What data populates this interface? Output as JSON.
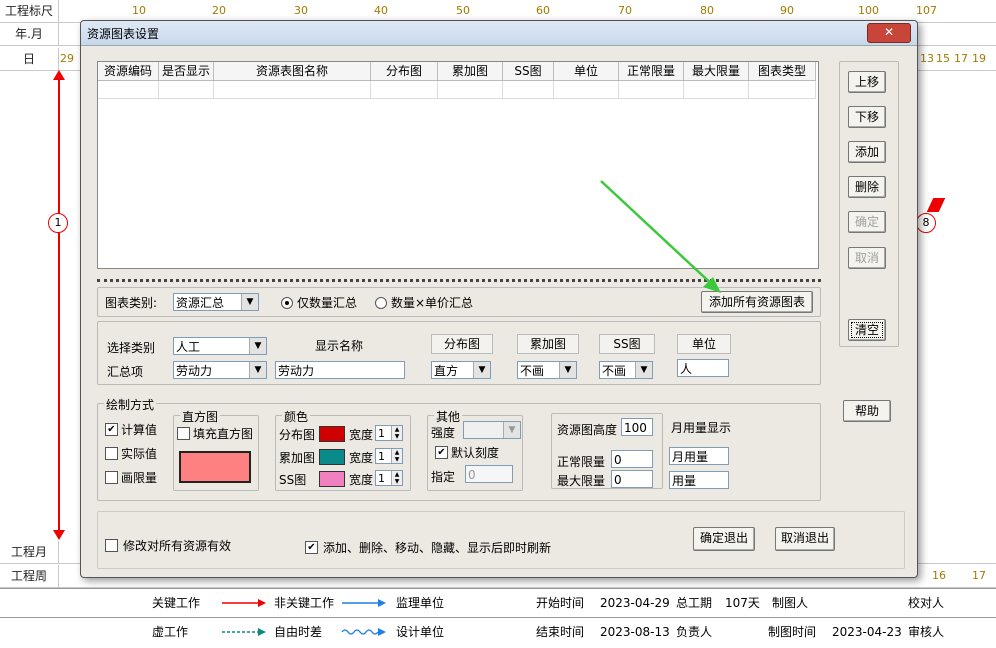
{
  "background": {
    "row_labels": {
      "ruler": "工程标尺",
      "year_month": "年.月",
      "day": "日",
      "project_month": "工程月",
      "project_week": "工程周"
    },
    "ruler_ticks": [
      "10",
      "20",
      "30",
      "40",
      "50",
      "60",
      "70",
      "80",
      "90",
      "100",
      "107"
    ],
    "day_first": "29",
    "day_right": [
      "13",
      "15",
      "17",
      "19"
    ],
    "week_right": [
      "16",
      "17"
    ],
    "node_left": "1",
    "node_right": "8",
    "legend": {
      "critical": "关键工作",
      "non_critical": "非关键工作",
      "supervisor": "监理单位",
      "start_time_label": "开始时间",
      "start_time": "2023-04-29",
      "total_duration_label": "总工期",
      "total_duration": "107天",
      "drawer": "制图人",
      "checker": "校对人",
      "virtual": "虚工作",
      "free_float": "自由时差",
      "designer": "设计单位",
      "end_time_label": "结束时间",
      "end_time": "2023-08-13",
      "manager": "负责人",
      "draw_time_label": "制图时间",
      "draw_time": "2023-04-23",
      "reviewer": "审核人"
    },
    "colors": {
      "critical": "#e00000",
      "non_critical": "#1e7fe6",
      "tick": "#a07a00"
    }
  },
  "dialog": {
    "title": "资源图表设置",
    "close_icon": "close-icon",
    "table": {
      "columns": [
        "资源编码",
        "是否显示",
        "资源表图名称",
        "分布图",
        "累加图",
        "SS图",
        "单位",
        "正常限量",
        "最大限量",
        "图表类型"
      ]
    },
    "side_buttons": {
      "up": "上移",
      "down": "下移",
      "add": "添加",
      "delete": "删除",
      "confirm": "确定",
      "cancel": "取消",
      "clear": "清空",
      "help": "帮助"
    },
    "chart_category": {
      "label": "图表类别:",
      "value": "资源汇总",
      "radio_qty": "仅数量汇总",
      "radio_price": "数量×单价汇总",
      "add_all": "添加所有资源图表"
    },
    "select_section": {
      "category_label": "选择类别",
      "category_value": "人工",
      "display_name_header": "显示名称",
      "summary_label": "汇总项",
      "summary_value": "劳动力",
      "display_name_value": "劳动力",
      "dist_header": "分布图",
      "dist_value": "直方",
      "cum_header": "累加图",
      "cum_value": "不画",
      "ss_header": "SS图",
      "ss_value": "不画",
      "unit_header": "单位",
      "unit_value": "人"
    },
    "draw_mode": {
      "title": "绘制方式",
      "calc": "计算值",
      "actual": "实际值",
      "limit": "画限量",
      "histogram_title": "直方图",
      "fill_histogram": "填充直方图",
      "histogram_color": "#ff8080",
      "color_title": "颜色",
      "dist_label": "分布图",
      "dist_color": "#d00000",
      "cum_label": "累加图",
      "cum_color": "#0a8a8a",
      "ss_label": "SS图",
      "ss_color": "#f080c0",
      "width_label": "宽度",
      "width_dist": "1",
      "width_cum": "1",
      "width_ss": "1",
      "other_title": "其他",
      "strength_label": "强度",
      "default_scale": "默认刻度",
      "specify_label": "指定",
      "specify_value": "0",
      "height_label": "资源图高度",
      "height_value": "100",
      "normal_limit_label": "正常限量",
      "normal_limit_value": "0",
      "max_limit_label": "最大限量",
      "max_limit_value": "0",
      "monthly_label": "月用量显示",
      "monthly_value": "月用量",
      "usage_value": "用量"
    },
    "bottom": {
      "apply_all": "修改对所有资源有效",
      "auto_refresh": "添加、删除、移动、隐藏、显示后即时刷新",
      "ok_exit": "确定退出",
      "cancel_exit": "取消退出"
    },
    "arrow_color": "#3cc83c"
  }
}
